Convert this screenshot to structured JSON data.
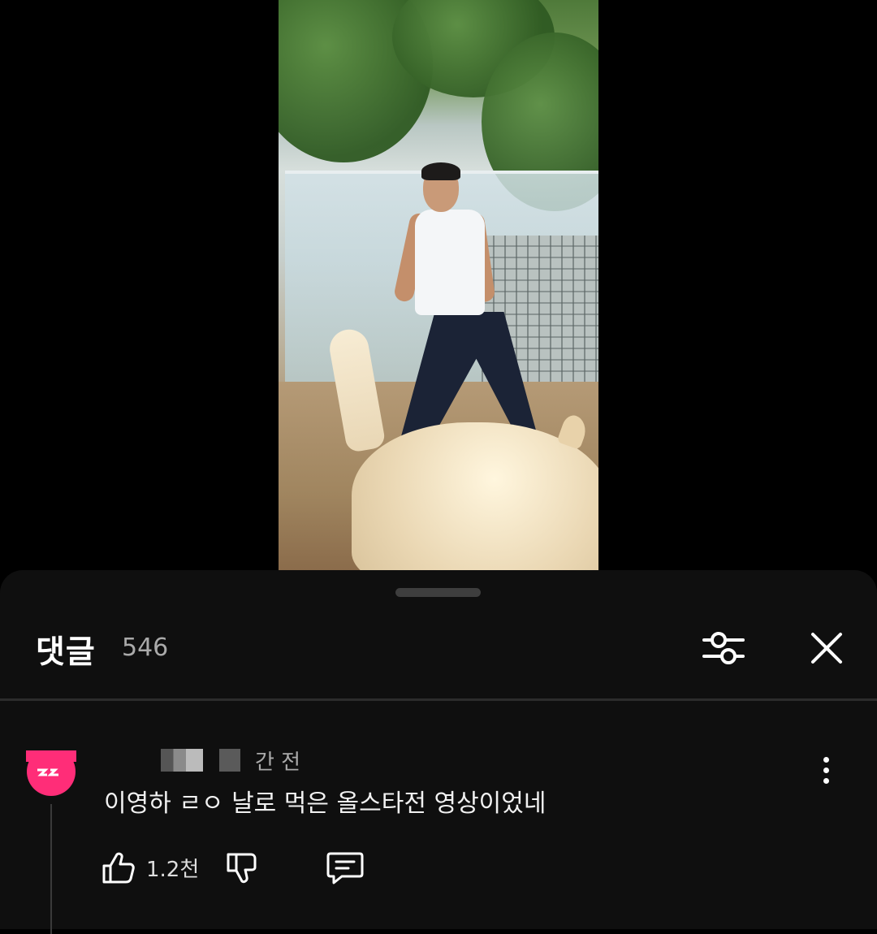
{
  "video": {
    "description_free": true
  },
  "comments_panel": {
    "title": "댓글",
    "count": "546",
    "filter_icon": "tune-sliders-icon",
    "close_icon": "close-icon"
  },
  "comment": {
    "time_suffix": "간 전",
    "text": "이영하 ㄹㅇ 날로 먹은 올스타전 영상이었네",
    "like_count": "1.2천",
    "icons": [
      "thumb-up-icon",
      "thumb-down-icon",
      "reply-icon",
      "more-vert-icon"
    ]
  },
  "colors": {
    "sheet_bg": "#0f0f0f",
    "avatar_accent": "#ff2d78"
  }
}
